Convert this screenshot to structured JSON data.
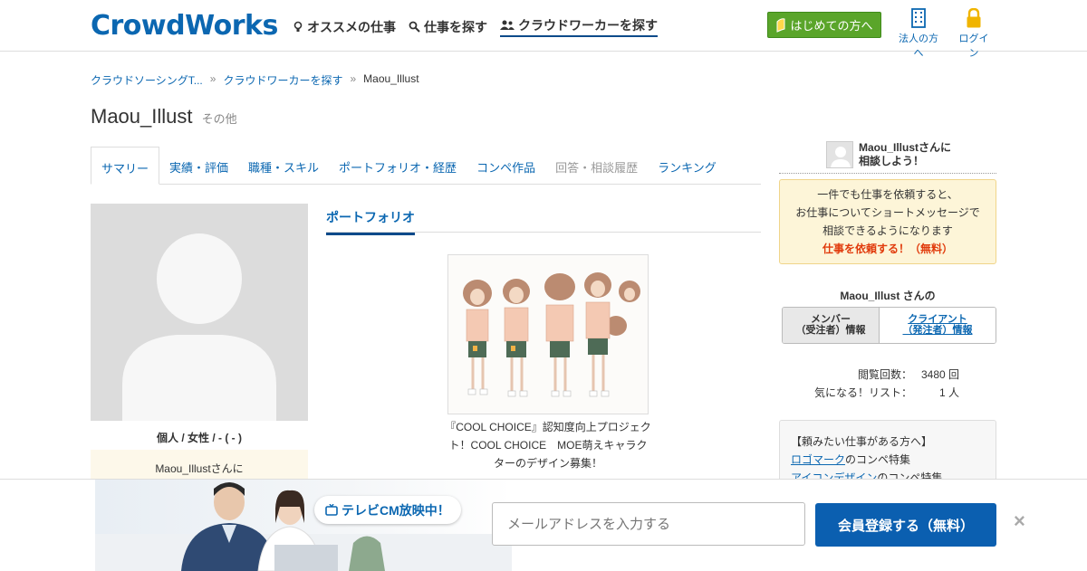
{
  "header": {
    "logo": "CrowdWorks",
    "nav": [
      {
        "label": "オススメの仕事",
        "icon": "bulb-icon"
      },
      {
        "label": "仕事を探す",
        "icon": "search-icon"
      },
      {
        "label": "クラウドワーカーを探す",
        "icon": "users-icon"
      }
    ],
    "start_button": "はじめての方へ",
    "corp_label": "法人の方へ",
    "login_label": "ログイン"
  },
  "breadcrumb": [
    "クラウドソーシングT...",
    "クラウドワーカーを探す",
    "Maou_Illust"
  ],
  "profile": {
    "name": "Maou_Illust",
    "category": "その他",
    "meta": "個人 / 女性 / - ( - )",
    "consult_left": "Maou_Illustさんに"
  },
  "tabs": [
    "サマリー",
    "実績・評価",
    "職種・スキル",
    "ポートフォリオ・経歴",
    "コンペ作品",
    "回答・相談履歴",
    "ランキング"
  ],
  "portfolio": {
    "heading": "ポートフォリオ",
    "caption": "『COOL CHOICE』認知度向上プロジェクト！COOL CHOICE　MOE萌えキャラクターのデザイン募集！"
  },
  "sidebar": {
    "consult_line1": "Maou_Illustさんに",
    "consult_line2": "相談しよう！",
    "notice_lines": [
      "一件でも仕事を依頼すると、",
      "お仕事についてショートメッセージで",
      "相談できるようになります"
    ],
    "notice_cta": "仕事を依頼する！（無料）",
    "info_title": "Maou_Illust さんの",
    "toggle_member_1": "メンバー",
    "toggle_member_2": "（受注者）情報",
    "toggle_client_1": "クライアント",
    "toggle_client_2": "（発注者）情報",
    "stats": [
      {
        "label": "閲覧回数：",
        "value": "3480 回"
      },
      {
        "label": "気になる！リスト：",
        "value": "1 人"
      }
    ],
    "request_title": "【頼みたい仕事がある方へ】",
    "request_links": [
      {
        "link": "ロゴマーク",
        "suffix": "のコンペ特集"
      },
      {
        "link": "アイコンデザイン",
        "suffix": "のコンペ特集"
      }
    ]
  },
  "footer": {
    "tvcm": "テレビCM放映中！",
    "email_placeholder": "メールアドレスを入力する",
    "signup_button": "会員登録する（無料）",
    "close": "×"
  },
  "colors": {
    "brand": "#0b67b1",
    "green": "#5aa52a",
    "alert": "#e13b0c",
    "signup": "#0b5fb0"
  }
}
